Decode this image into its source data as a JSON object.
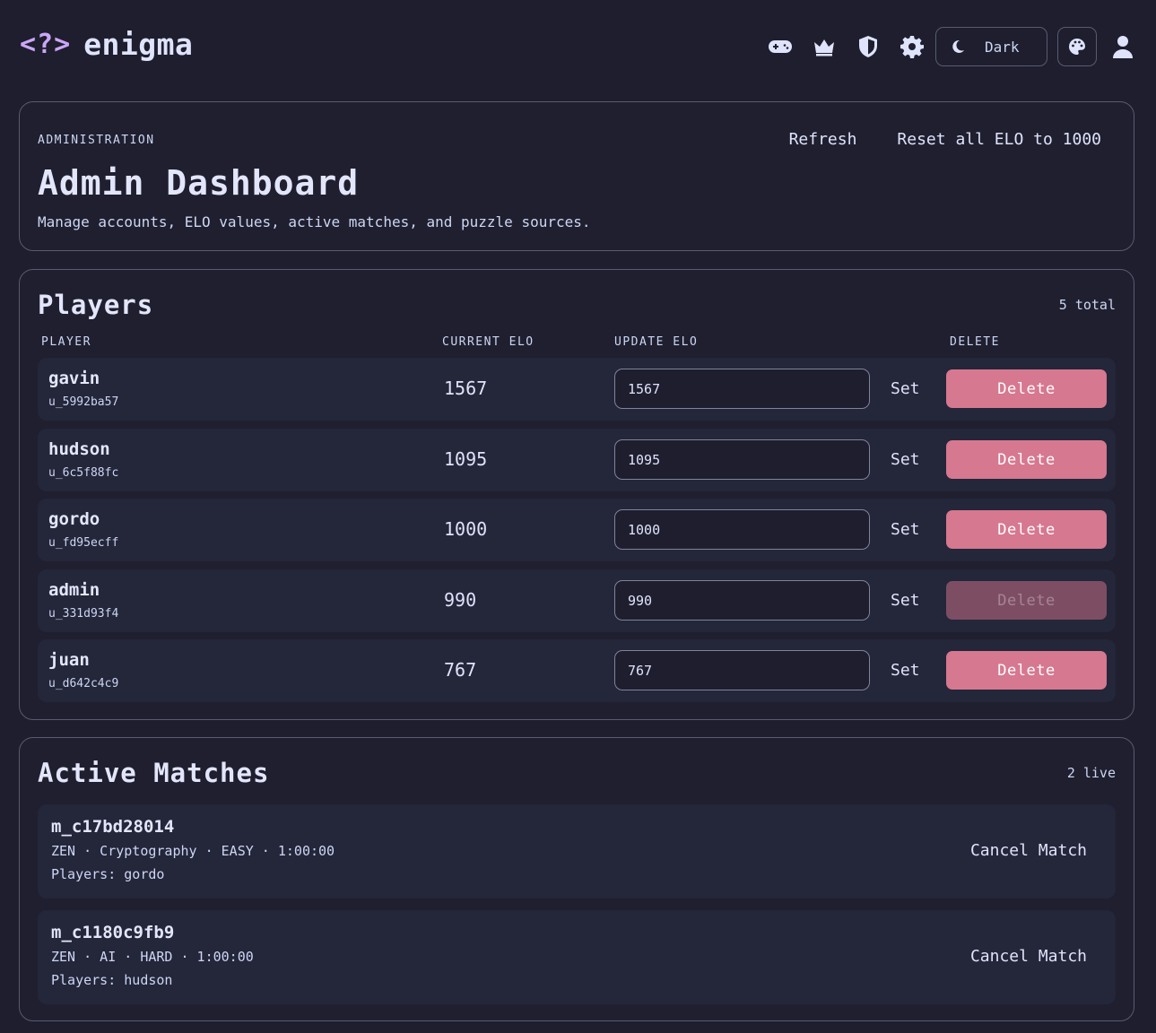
{
  "header": {
    "logo_glyph": "<?>",
    "brand": "enigma",
    "theme_label": "Dark",
    "icons": [
      "gamepad-icon",
      "crown-icon",
      "shield-icon",
      "gear-icon",
      "moon-icon",
      "palette-icon",
      "user-icon"
    ]
  },
  "admin": {
    "eyebrow": "ADMINISTRATION",
    "title": "Admin Dashboard",
    "description": "Manage accounts, ELO values, active matches, and puzzle sources.",
    "refresh_label": "Refresh",
    "reset_label": "Reset all ELO to 1000"
  },
  "players": {
    "title": "Players",
    "count": "5 total",
    "columns": {
      "player": "PLAYER",
      "current_elo": "CURRENT ELO",
      "update_elo": "UPDATE ELO",
      "delete": "DELETE"
    },
    "set_label": "Set",
    "delete_label": "Delete",
    "rows": [
      {
        "name": "gavin",
        "id": "u_5992ba57",
        "elo": "1567",
        "input": "1567",
        "delete_enabled": true
      },
      {
        "name": "hudson",
        "id": "u_6c5f88fc",
        "elo": "1095",
        "input": "1095",
        "delete_enabled": true
      },
      {
        "name": "gordo",
        "id": "u_fd95ecff",
        "elo": "1000",
        "input": "1000",
        "delete_enabled": true
      },
      {
        "name": "admin",
        "id": "u_331d93f4",
        "elo": "990",
        "input": "990",
        "delete_enabled": false
      },
      {
        "name": "juan",
        "id": "u_d642c4c9",
        "elo": "767",
        "input": "767",
        "delete_enabled": true
      }
    ]
  },
  "matches": {
    "title": "Active Matches",
    "count": "2 live",
    "cancel_label": "Cancel Match",
    "rows": [
      {
        "id": "m_c17bd28014",
        "meta": "ZEN · Cryptography · EASY · 1:00:00",
        "players": "Players: gordo"
      },
      {
        "id": "m_c1180c9fb9",
        "meta": "ZEN · AI · HARD · 1:00:00",
        "players": "Players: hudson"
      }
    ]
  },
  "colors": {
    "background": "#1e1e2e",
    "accent": "#cba6f7",
    "delete": "#d6788f",
    "delete_disabled": "#7d4e63"
  }
}
